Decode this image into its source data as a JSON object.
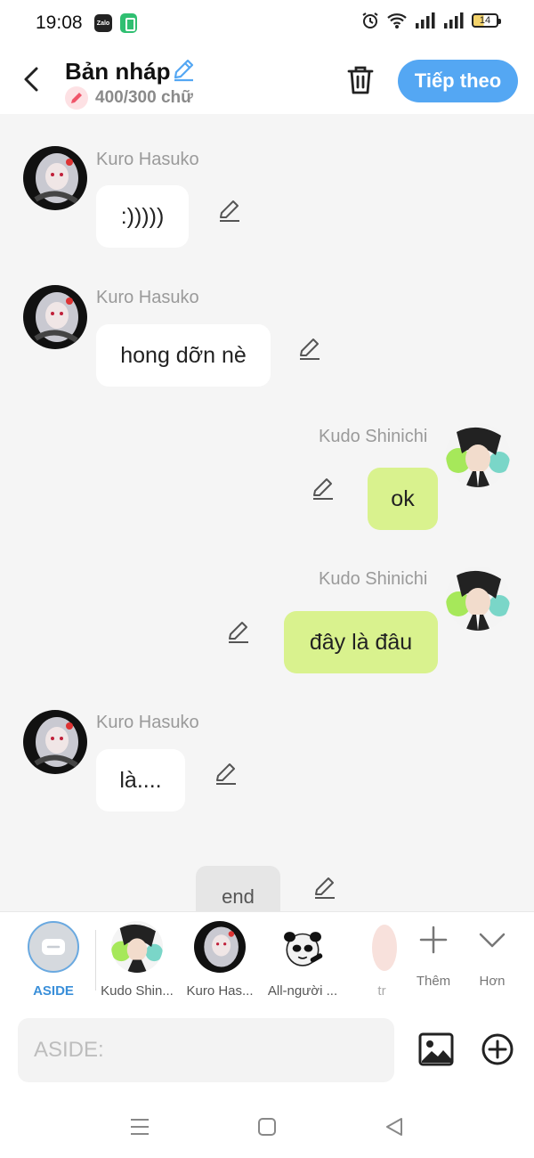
{
  "status_bar": {
    "time": "19:08",
    "app_badge": "Zalo",
    "battery": "14"
  },
  "header": {
    "title": "Bản nháp",
    "counter": "400/300 chữ",
    "next_label": "Tiếp theo"
  },
  "messages": [
    {
      "sender": "Kuro Hasuko",
      "text": ":)))))",
      "side": "left"
    },
    {
      "sender": "Kuro Hasuko",
      "text": "hong dỡn nè",
      "side": "left"
    },
    {
      "sender": "Kudo Shinichi",
      "text": "ok",
      "side": "right"
    },
    {
      "sender": "Kudo Shinichi",
      "text": "đây là đâu",
      "side": "right"
    },
    {
      "sender": "Kuro Hasuko",
      "text": "là....",
      "side": "left"
    },
    {
      "sender": "",
      "text": "end",
      "side": "center"
    }
  ],
  "character_bar": {
    "items": [
      {
        "label": "ASIDE"
      },
      {
        "label": "Kudo Shin..."
      },
      {
        "label": "Kuro Has..."
      },
      {
        "label": "All-người ..."
      },
      {
        "label": "tr"
      }
    ],
    "add_label": "Thêm",
    "more_label": "Hơn"
  },
  "composer": {
    "placeholder": "ASIDE:"
  },
  "colors": {
    "accent": "#54a7f3",
    "right_bubble": "#d9f28e",
    "left_bubble": "#ffffff",
    "background": "#f5f5f5"
  }
}
